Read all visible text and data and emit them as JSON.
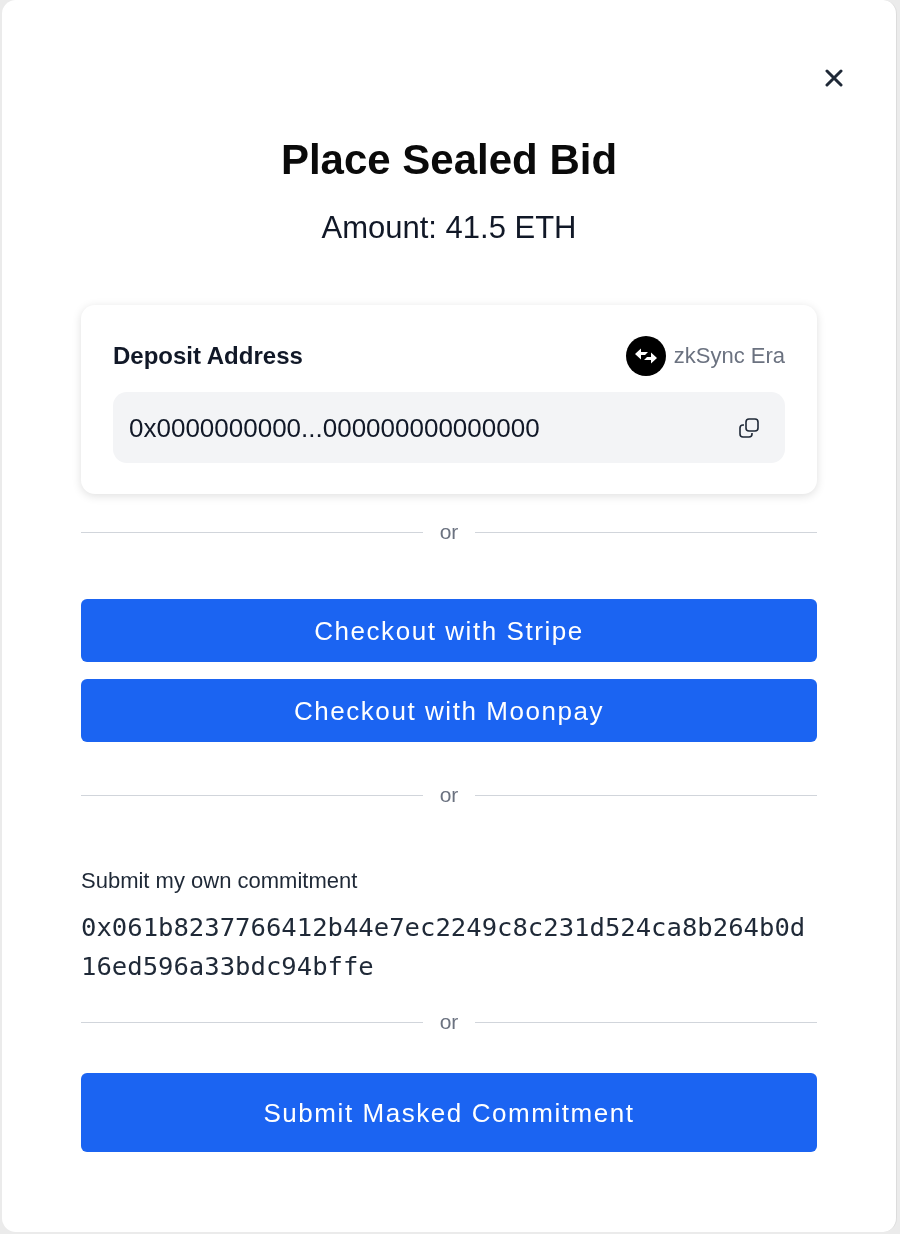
{
  "dialog": {
    "title": "Place Sealed Bid",
    "amount": "Amount: 41.5 ETH"
  },
  "deposit": {
    "label": "Deposit Address",
    "network": "zkSync Era",
    "address": "0x0000000000...000000000000000"
  },
  "blocks": [
    {
      "kind": "divider",
      "label": "or"
    },
    {
      "kind": "button",
      "label": "Checkout with Stripe"
    },
    {
      "kind": "button",
      "label": "Checkout with Moonpay"
    },
    {
      "kind": "divider",
      "label": "or"
    },
    {
      "kind": "commitment",
      "label": "Submit my own commitment",
      "value": "0x061b8237766412b44e7ec2249c8c231d524ca8b264b0d16ed596a33bdc94bffe"
    },
    {
      "kind": "divider",
      "label": "or"
    },
    {
      "kind": "large_button",
      "label": "Submit Masked Commitment"
    }
  ]
}
